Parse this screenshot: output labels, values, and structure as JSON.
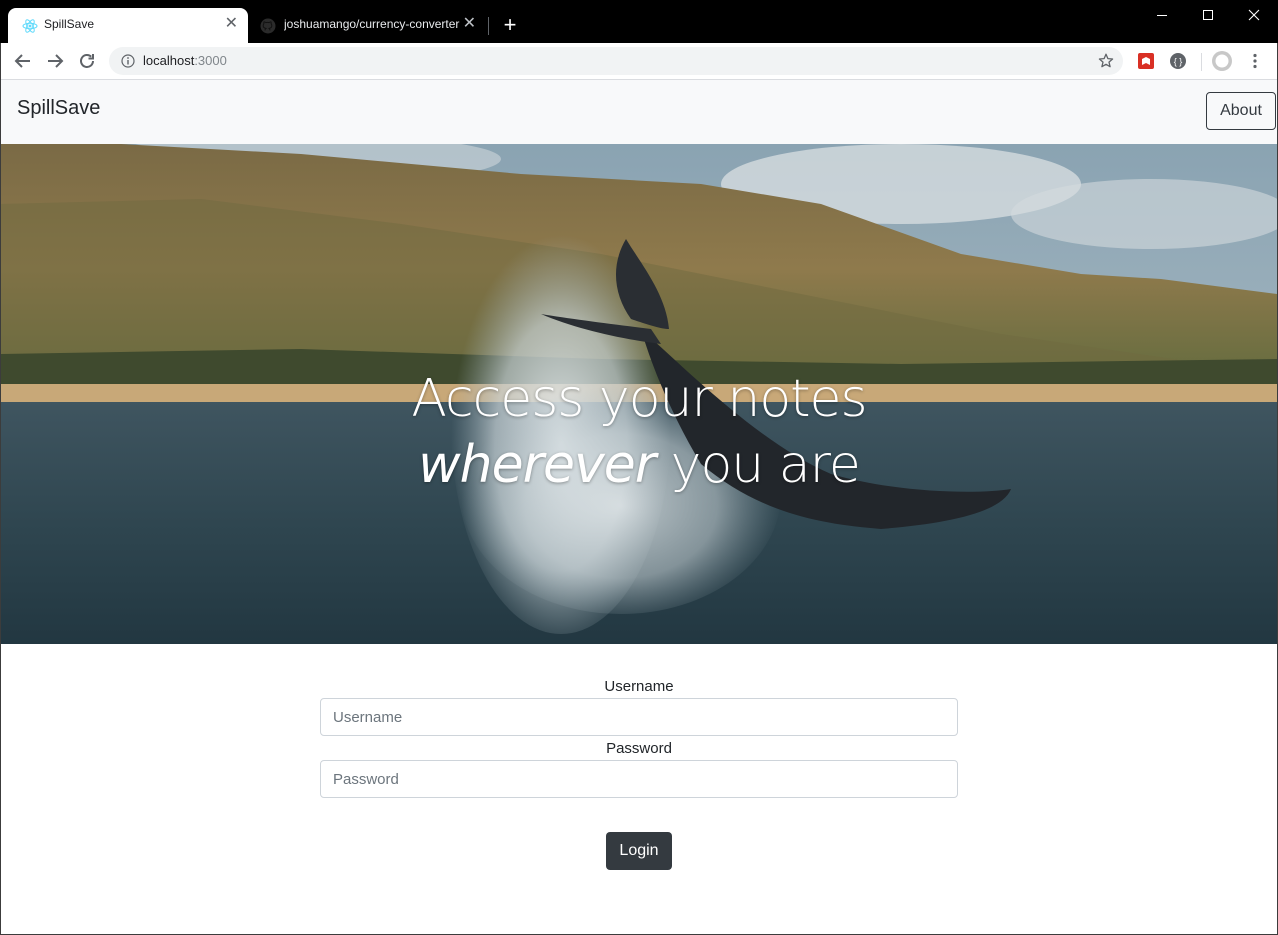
{
  "browser": {
    "tabs": [
      {
        "title": "SpillSave",
        "active": true,
        "icon": "react-icon"
      },
      {
        "title": "joshuamango/currency-converter",
        "active": false,
        "icon": "github-icon"
      }
    ],
    "new_tab_label": "+",
    "address": {
      "host": "localhost",
      "port": ":3000"
    },
    "window_controls": {
      "minimize": "minimize-icon",
      "maximize": "maximize-icon",
      "close": "close-icon"
    }
  },
  "navbar": {
    "brand": "SpillSave",
    "about_label": "About"
  },
  "hero": {
    "line1": "Access your notes",
    "line2_emphasis": "wherever",
    "line2_rest": " you are"
  },
  "form": {
    "username_label": "Username",
    "username_placeholder": "Username",
    "password_label": "Password",
    "password_placeholder": "Password",
    "login_label": "Login"
  },
  "colors": {
    "chrome_bg": "#000000",
    "navbar_bg": "#f8f9fa",
    "button_dark": "#343a40",
    "react_blue": "#61dafb"
  }
}
